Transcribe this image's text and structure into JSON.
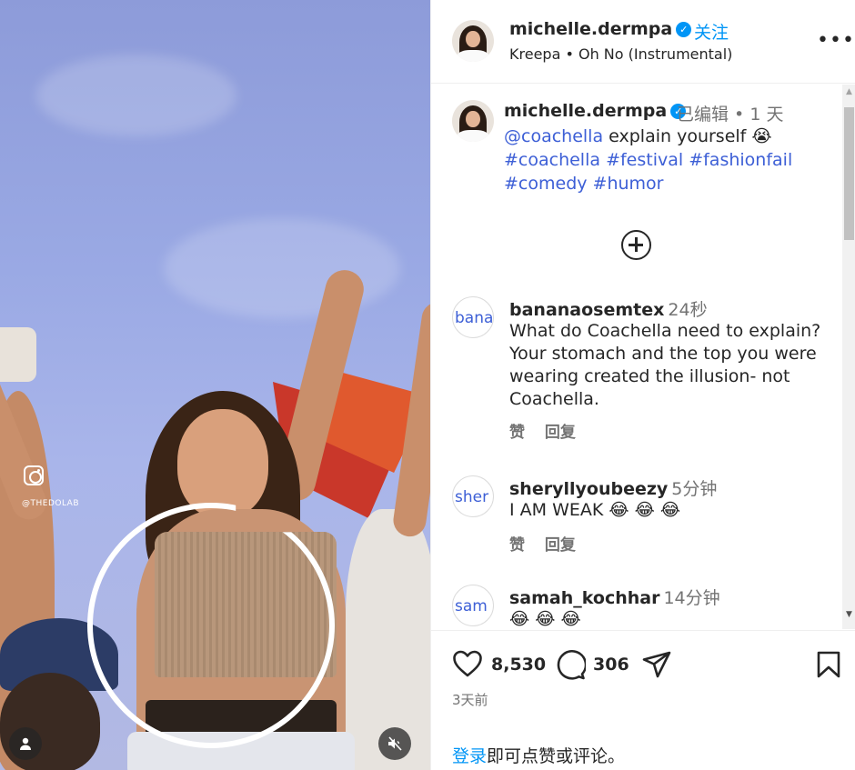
{
  "media": {
    "watermark": "@THEDOLAB",
    "icons": {
      "user": "user-icon",
      "mute": "speaker-muted-icon",
      "instagram": "instagram-icon"
    }
  },
  "header": {
    "username": "michelle.dermpa",
    "follow_label": "关注",
    "audio": "Kreepa • Oh No (Instrumental)",
    "more_label": "•••"
  },
  "caption": {
    "username": "michelle.dermpa",
    "edited": "已编辑",
    "time": "1 天",
    "mention": "@coachella",
    "text": "explain yourself 😭",
    "hashtags": [
      "#coachella",
      "#festival",
      "#fashionfail",
      "#comedy",
      "#humor"
    ]
  },
  "comments": [
    {
      "avatar_alt": "banan",
      "username": "bananaosemtex",
      "time": "24秒",
      "text": "What do Coachella need to explain? Your stomach and the top you were wearing created the illusion- not Coachella.",
      "like_label": "赞",
      "reply_label": "回复"
    },
    {
      "avatar_alt": "sher",
      "username": "sheryllyoubeezy",
      "time": "5分钟",
      "text": "I AM WEAK 😂 😂 😂",
      "like_label": "赞",
      "reply_label": "回复"
    },
    {
      "avatar_alt": "sam",
      "username": "samah_kochhar",
      "time": "14分钟",
      "text": "😂 😂 😂",
      "like_label": "赞",
      "reply_label": "回复"
    }
  ],
  "footer": {
    "likes": "8,530",
    "comments": "306",
    "date": "3天前",
    "login_link": "登录",
    "login_rest": "即可点赞或评论。"
  },
  "colors": {
    "accent": "#0095f6",
    "link": "#3d5fd6",
    "muted": "#737373"
  }
}
